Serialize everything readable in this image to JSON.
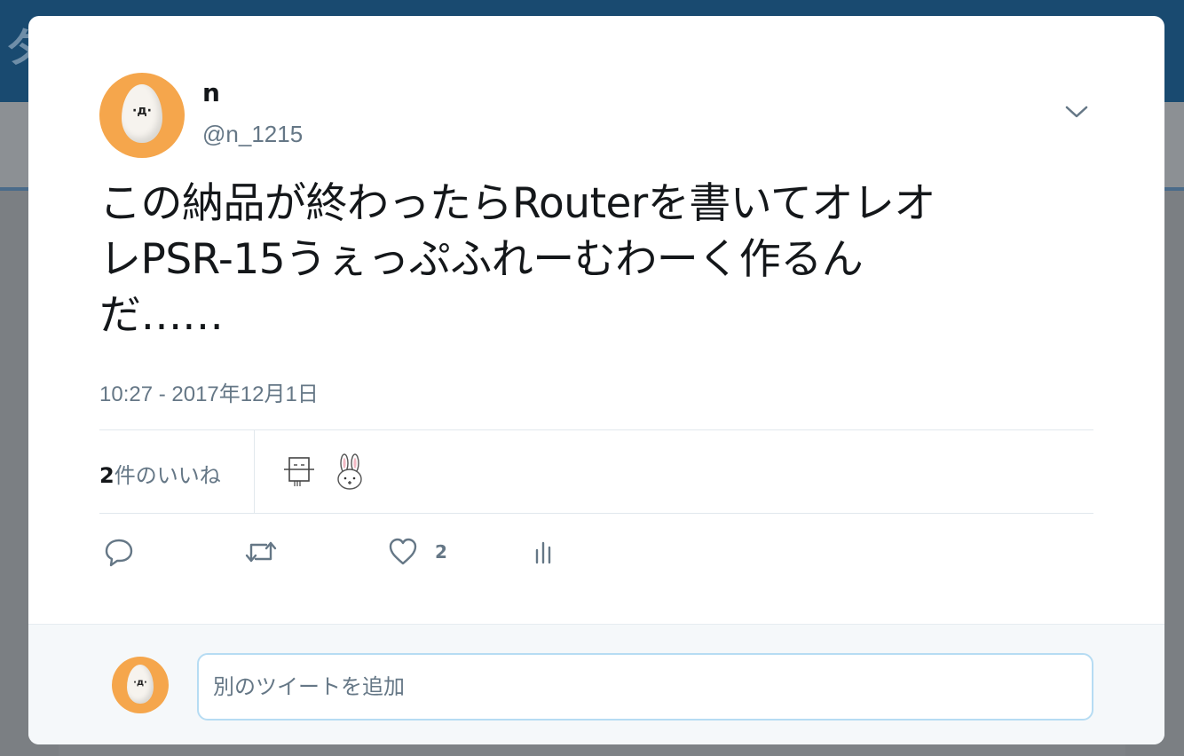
{
  "background": {
    "title_fragment": "タ",
    "action_counts": "2"
  },
  "tweet": {
    "author": {
      "name": "n",
      "handle": "@n_1215",
      "avatar_face": "·д·",
      "avatar_color": "#f5a64c"
    },
    "text_lines": [
      "この納品が終わったらRouterを書いてオレオ",
      "レPSR-15うぇっぷふれーむわーく作るん",
      "だ……"
    ],
    "timestamp": "10:27 - 2017年12月1日",
    "likes": {
      "count": "2",
      "label": "件のいいね",
      "likers": [
        "box-face-avatar",
        "rabbit-avatar"
      ]
    },
    "actions": {
      "reply_icon": "reply-icon",
      "retweet_icon": "retweet-icon",
      "like_icon": "heart-icon",
      "like_count": "2",
      "analytics_icon": "analytics-icon"
    },
    "menu_icon": "chevron-down-icon"
  },
  "reply": {
    "avatar_face": "·д·",
    "placeholder": "別のツイートを追加"
  },
  "colors": {
    "text_primary": "#14171a",
    "text_secondary": "#657786",
    "border": "#e1e8ed",
    "input_border": "#b6dcf3",
    "reply_bg": "#f5f8fa"
  }
}
